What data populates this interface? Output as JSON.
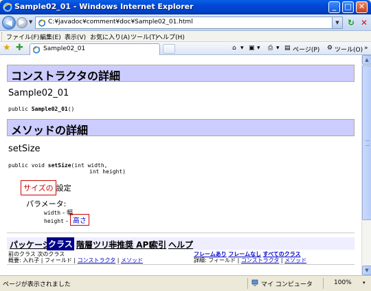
{
  "window": {
    "title": "Sample02_01 - Windows Internet Explorer",
    "buttons": {
      "minimize": "_",
      "maximize": "□",
      "close": "✕"
    }
  },
  "address_bar": {
    "url": "C:¥javadoc¥comment¥doc¥Sample02_01.html"
  },
  "menu": [
    "ファイル(F)",
    "編集(E)",
    "表示(V)",
    "お気に入り(A)",
    "ツール(T)",
    "ヘルプ(H)"
  ],
  "tabs": [
    {
      "label": "Sample02_01",
      "active": true
    }
  ],
  "command_bar": {
    "home": "▾",
    "feeds": "▾",
    "print": "▾",
    "page": "ページ(P)",
    "tools": "ツール(O)",
    "more": "»"
  },
  "page": {
    "constructor_header": "コンストラクタの詳細",
    "constructor_name": "Sample02_01",
    "constructor_signature_prefix": "public ",
    "constructor_signature_name": "Sample02_01",
    "constructor_signature_suffix": "()",
    "method_header": "メソッドの詳細",
    "method_name": "setSize",
    "method_signature_prefix": "public void ",
    "method_signature_name": "setSize",
    "method_signature_line1_suffix": "(int width,",
    "method_signature_line2": "int height)",
    "description_highlight": "サイズの",
    "description_rest": "設定",
    "params_label": "パラメータ:",
    "params": [
      {
        "name": "width",
        "dash": " - ",
        "desc": "幅"
      },
      {
        "name": "height",
        "dash": " - ",
        "desc": "高さ"
      }
    ]
  },
  "navbar": {
    "items": [
      "パッケージ",
      "クラス",
      "階層ツリー",
      "非推奨 API",
      "索引",
      "ヘルプ"
    ],
    "current": "クラス"
  },
  "subnav": {
    "prev_next": "前のクラス  次のクラス",
    "frames": "フレームあり",
    "noframes": "フレームなし",
    "allclasses": "すべてのクラス",
    "summary_label": "概要: 入れ子 | フィールド | ",
    "summary_ctor": "コンストラクタ",
    "summary_sep": " | ",
    "summary_method": "メソッド",
    "detail_label": "詳細: フィールド | ",
    "detail_ctor": "コンストラクタ",
    "detail_sep": " | ",
    "detail_method": "メソッド"
  },
  "status": {
    "text": "ページが表示されました",
    "zone": "マイ コンピュータ",
    "zoom": "100%",
    "zoom_dropdown": "▾"
  },
  "colors": {
    "section_header_bg": "#ccccff",
    "navbar_current_bg": "#00008b",
    "highlight_border": "#cc0000",
    "link": "#0000cc"
  }
}
